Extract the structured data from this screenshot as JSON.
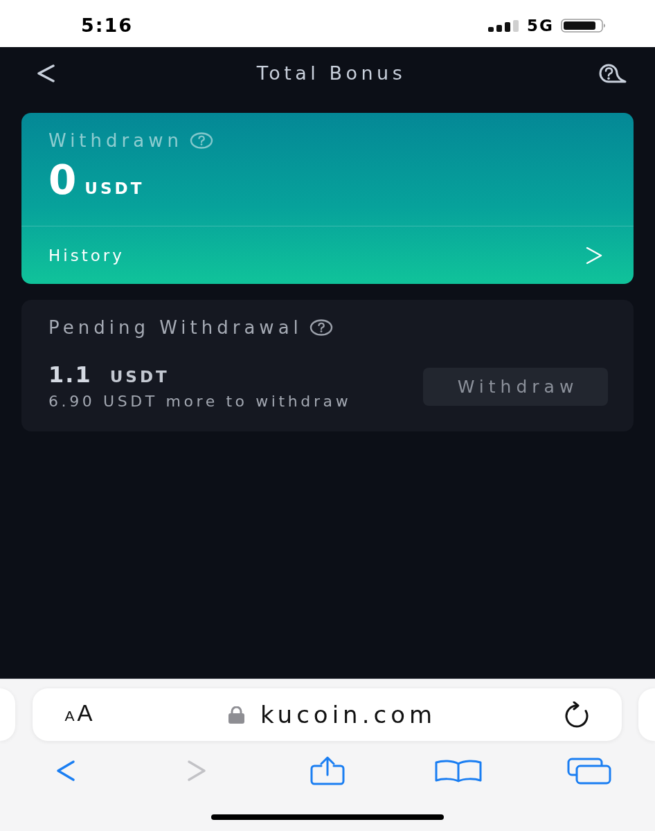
{
  "status_bar": {
    "time": "5:16",
    "network": "5G"
  },
  "header": {
    "title": "Total Bonus"
  },
  "withdrawn_card": {
    "label": "Withdrawn",
    "amount": "0",
    "unit": "USDT",
    "link": "History"
  },
  "pending_card": {
    "label": "Pending Withdrawal",
    "amount": "1.1",
    "unit": "USDT",
    "note": "6.90 USDT more to withdraw",
    "button": {
      "label": "Withdraw",
      "disabled": true
    }
  },
  "browser": {
    "text_size": "AA",
    "url": "kucoin.com",
    "toolbar": [
      {
        "kind": "back",
        "disabled": false
      },
      {
        "kind": "forward",
        "disabled": true
      },
      {
        "kind": "share",
        "disabled": false
      },
      {
        "kind": "bookmarks",
        "disabled": false
      },
      {
        "kind": "tabs",
        "disabled": false
      }
    ]
  }
}
